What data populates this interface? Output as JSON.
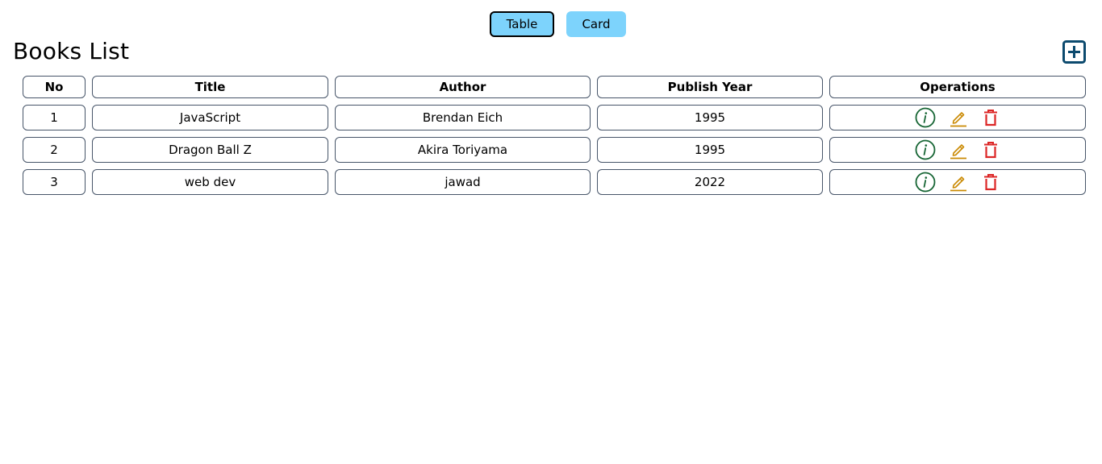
{
  "view_toggle": {
    "table_label": "Table",
    "card_label": "Card",
    "active": "Table"
  },
  "page_title": "Books List",
  "table": {
    "headers": {
      "no": "No",
      "title": "Title",
      "author": "Author",
      "year": "Publish Year",
      "operations": "Operations"
    },
    "rows": [
      {
        "no": "1",
        "title": "JavaScript",
        "author": "Brendan Eich",
        "year": "1995"
      },
      {
        "no": "2",
        "title": "Dragon Ball Z",
        "author": "Akira Toriyama",
        "year": "1995"
      },
      {
        "no": "3",
        "title": "web dev",
        "author": "jawad",
        "year": "2022"
      }
    ]
  },
  "icons": {
    "add": "add-box-icon",
    "info": "info-circle-icon",
    "edit": "pencil-icon",
    "delete": "trash-icon"
  },
  "colors": {
    "toggle_bg": "#7dd3fc",
    "add_icon": "#0c4a6e",
    "info_icon": "#166534",
    "edit_icon": "#ca8a04",
    "delete_icon": "#dc2626",
    "cell_border": "#475569"
  }
}
